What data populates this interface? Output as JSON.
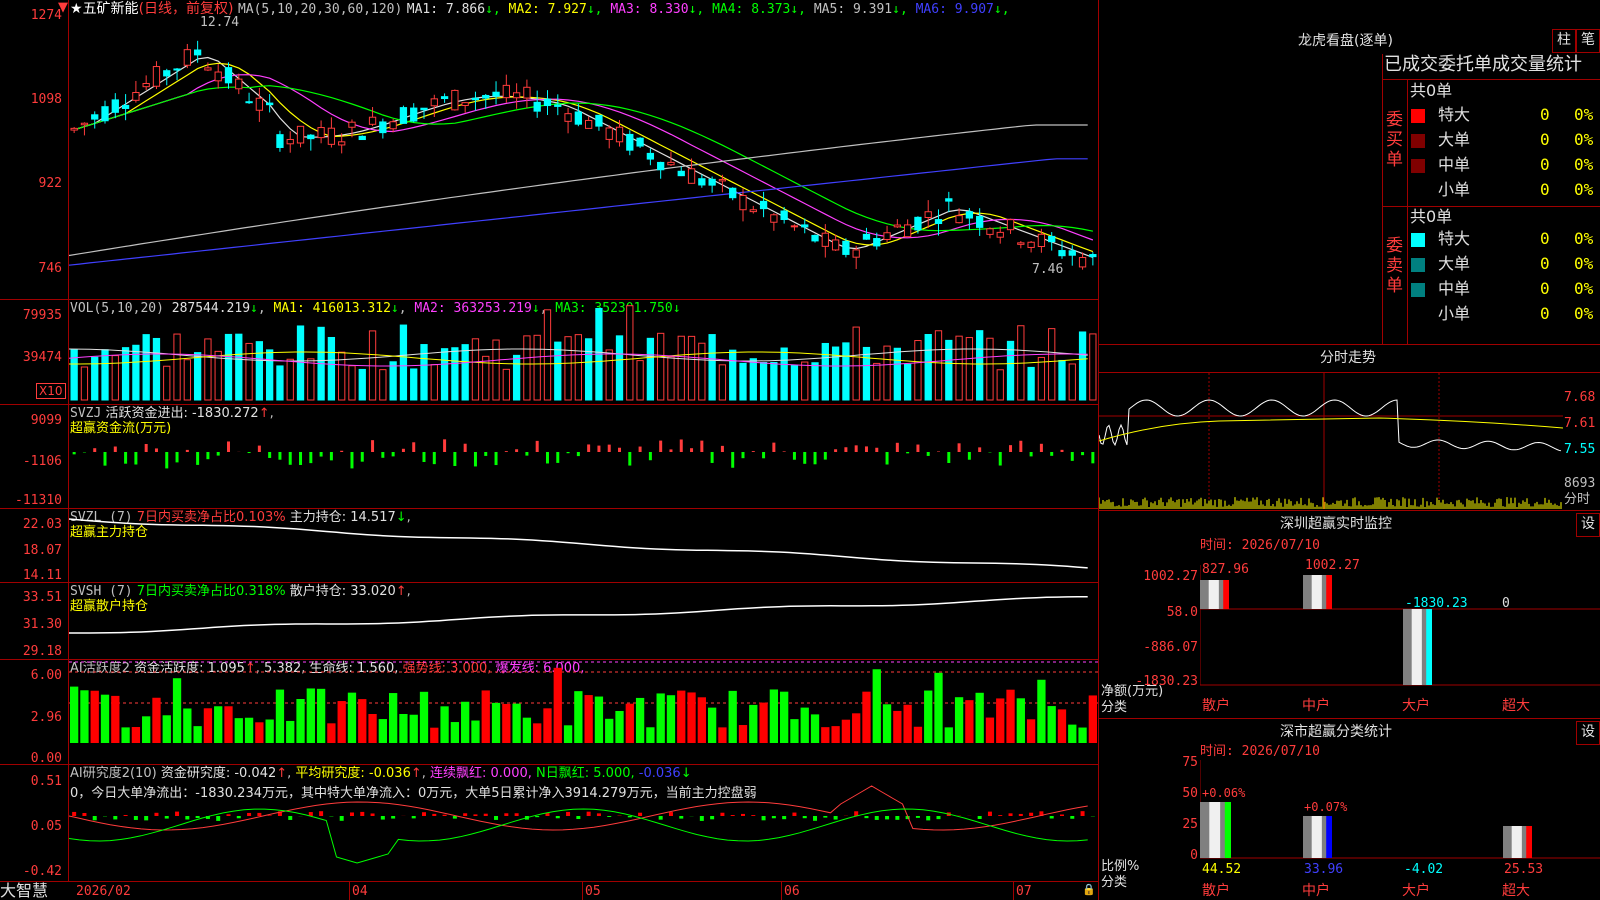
{
  "stock": {
    "star": "★",
    "name": "五矿新能",
    "period": "(日线，前复权)",
    "ma_label": "MA(5,10,20,30,60,120)",
    "ma": [
      {
        "label": "MA1: 7.866",
        "color": "#e0e0e0"
      },
      {
        "label": "MA2: 7.927",
        "color": "#ffff00"
      },
      {
        "label": "MA3: 8.330",
        "color": "#ff40ff"
      },
      {
        "label": "MA4: 8.373",
        "color": "#00ff00"
      },
      {
        "label": "MA5: 9.391",
        "color": "#c0c0c0"
      },
      {
        "label": "MA6: 9.907",
        "color": "#4040ff"
      }
    ],
    "high_mark": "12.74",
    "low_mark": "7.46",
    "y_labels": [
      "1274",
      "1098",
      "922",
      "746"
    ],
    "y_values": [
      12.74,
      10.98,
      9.22,
      7.46
    ]
  },
  "vol": {
    "title": "VOL(5,10,20)",
    "value": "287544.219",
    "ma1": "MA1: 416013.312",
    "ma2": "MA2: 363253.219",
    "ma3": "MA3: 352301.750",
    "y_labels": [
      "79935",
      "39474"
    ],
    "unit": "X10"
  },
  "svzj": {
    "title": "SVZJ",
    "desc": "活跃资金进出: -1830.272",
    "sub": "超赢资金流(万元)",
    "y_labels": [
      "9099",
      "-1106",
      "-11310"
    ]
  },
  "svzl": {
    "title": "SVZL (7)",
    "desc": "7日内买卖净占比0.103%",
    "hold": "主力持仓: 14.517",
    "sub": "超赢主力持仓",
    "y_labels": [
      "22.03",
      "18.07",
      "14.11"
    ]
  },
  "svsh": {
    "title": "SVSH (7)",
    "desc": "7日内买卖净占比0.318%",
    "hold": "散户持仓: 33.020",
    "sub": "超赢散户持仓",
    "y_labels": [
      "33.51",
      "31.30",
      "29.18"
    ]
  },
  "ai1": {
    "title": "AI活跃度2",
    "a": "资金活跃度: 1.095",
    "b": "5.382,",
    "c": "生命线: 1.560,",
    "d": "强势线: 3.000,",
    "e": "爆发线: 6.000,",
    "y_labels": [
      "6.00",
      "2.96",
      "0.00"
    ]
  },
  "ai2": {
    "title": "AI研究度2(10)",
    "a": "资金研究度: -0.042",
    "b": "平均研究度: -0.036",
    "c": "连续飘红: 0.000,",
    "d": "N日飘红: 5.000,",
    "e": "-0.036",
    "summary": "0，今日大单净流出：-1830.234万元，其中特大单净流入：0万元，大单5日累计净入3914.279万元，当前主力控盘弱",
    "y_labels": [
      "0.51",
      "0.05",
      "-0.42"
    ]
  },
  "bottom": {
    "brand": "大智慧",
    "dates": [
      "2026/02",
      "04",
      "05",
      "06",
      "07"
    ]
  },
  "right": {
    "top_title": "龙虎看盘(逐单)",
    "btn_zhu": "柱",
    "btn_bi": "笔",
    "section": "已成交委托单成交量统计",
    "buy": {
      "label": "委买单",
      "total": "共0单",
      "rows": [
        {
          "name": "特大",
          "count": "0",
          "pct": "0%",
          "color": "#ff0000"
        },
        {
          "name": "大单",
          "count": "0",
          "pct": "0%",
          "color": "#800000"
        },
        {
          "name": "中单",
          "count": "0",
          "pct": "0%",
          "color": "#800000"
        },
        {
          "name": "小单",
          "count": "0",
          "pct": "0%",
          "color": "#000000"
        }
      ]
    },
    "sell": {
      "label": "委卖单",
      "total": "共0单",
      "rows": [
        {
          "name": "特大",
          "count": "0",
          "pct": "0%",
          "color": "#00ffff"
        },
        {
          "name": "大单",
          "count": "0",
          "pct": "0%",
          "color": "#008080"
        },
        {
          "name": "中单",
          "count": "0",
          "pct": "0%",
          "color": "#008080"
        },
        {
          "name": "小单",
          "count": "0",
          "pct": "0%",
          "color": "#000000"
        }
      ]
    },
    "intraday": {
      "title": "分时走势",
      "y_labels": [
        "7.68",
        "7.61",
        "7.55"
      ],
      "vol_label": "8693",
      "unit": "分时"
    },
    "sz_monitor": {
      "title": "深圳超赢实时监控",
      "btn": "设",
      "time": "时间: 2026/07/10",
      "y_labels": [
        "1002.27",
        "58.0",
        "-886.07",
        "-1830.23"
      ],
      "axis_unit": "净额(万元)",
      "axis_cat": "分类",
      "cats": [
        "散户",
        "中户",
        "大户",
        "超大"
      ],
      "values": [
        "827.96",
        "1002.27",
        "-1830.23",
        "0"
      ]
    },
    "sz_stats": {
      "title": "深市超赢分类统计",
      "btn": "设",
      "time": "时间: 2026/07/10",
      "y_labels": [
        "75",
        "50",
        "25",
        "0"
      ],
      "axis_unit": "比例%",
      "axis_cat": "分类",
      "cats": [
        "散户",
        "中户",
        "大户",
        "超大"
      ],
      "changes": [
        "+0.06%",
        "+0.07%"
      ],
      "values": [
        "44.52",
        "33.96",
        "-4.02",
        "25.53"
      ]
    }
  }
}
